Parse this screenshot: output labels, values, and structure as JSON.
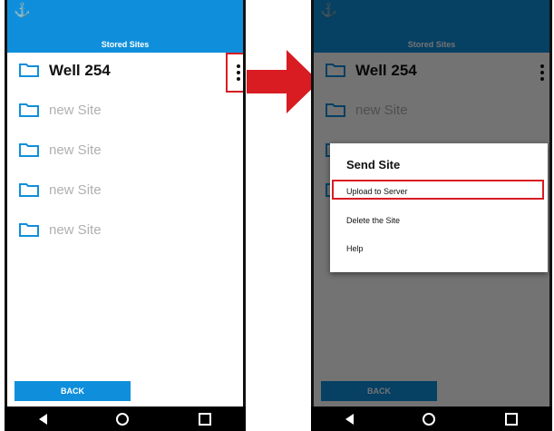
{
  "app": {
    "title": "Stored Sites",
    "status_icon": "anchor-icon"
  },
  "sites": [
    {
      "label": "Well 254"
    },
    {
      "label": "new Site"
    },
    {
      "label": "new Site"
    },
    {
      "label": "new Site"
    },
    {
      "label": "new Site"
    }
  ],
  "back_button": "BACK",
  "dialog": {
    "title": "Send Site",
    "items": [
      "Upload to Server",
      "Delete the Site",
      "Help"
    ]
  },
  "colors": {
    "accent": "#0f8fdb",
    "highlight": "#d81c22"
  }
}
